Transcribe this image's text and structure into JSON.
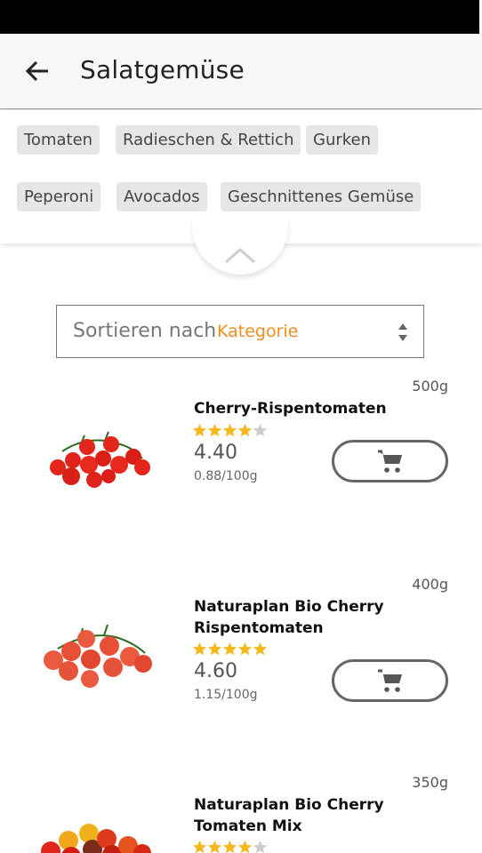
{
  "header": {
    "title": "Salatgemüse",
    "back_icon": "arrow-left-icon"
  },
  "filters": {
    "chips": [
      "Tomaten",
      "Radieschen & Rettich",
      "Gurken",
      "Peperoni",
      "Avocados",
      "Geschnittenes Gemüse"
    ]
  },
  "sort": {
    "label": "Sortieren nach",
    "value": "Kategorie"
  },
  "colors": {
    "accent": "#f28c1c",
    "star": "#f5b81c",
    "star_empty": "#cccccc",
    "tomato_red": "#e3261b"
  },
  "products": [
    {
      "name_line1": "Cherry-Rispentomaten",
      "name_line2": "",
      "weight": "500g",
      "price": "4.40",
      "unit_price": "0.88/100g",
      "rating": 4
    },
    {
      "name_line1": "Naturaplan Bio Cherry",
      "name_line2": "Rispentomaten",
      "weight": "400g",
      "price": "4.60",
      "unit_price": "1.15/100g",
      "rating": 5
    },
    {
      "name_line1": "Naturaplan Bio Cherry",
      "name_line2": "Tomaten Mix",
      "weight": "350g",
      "rating": 4
    }
  ]
}
